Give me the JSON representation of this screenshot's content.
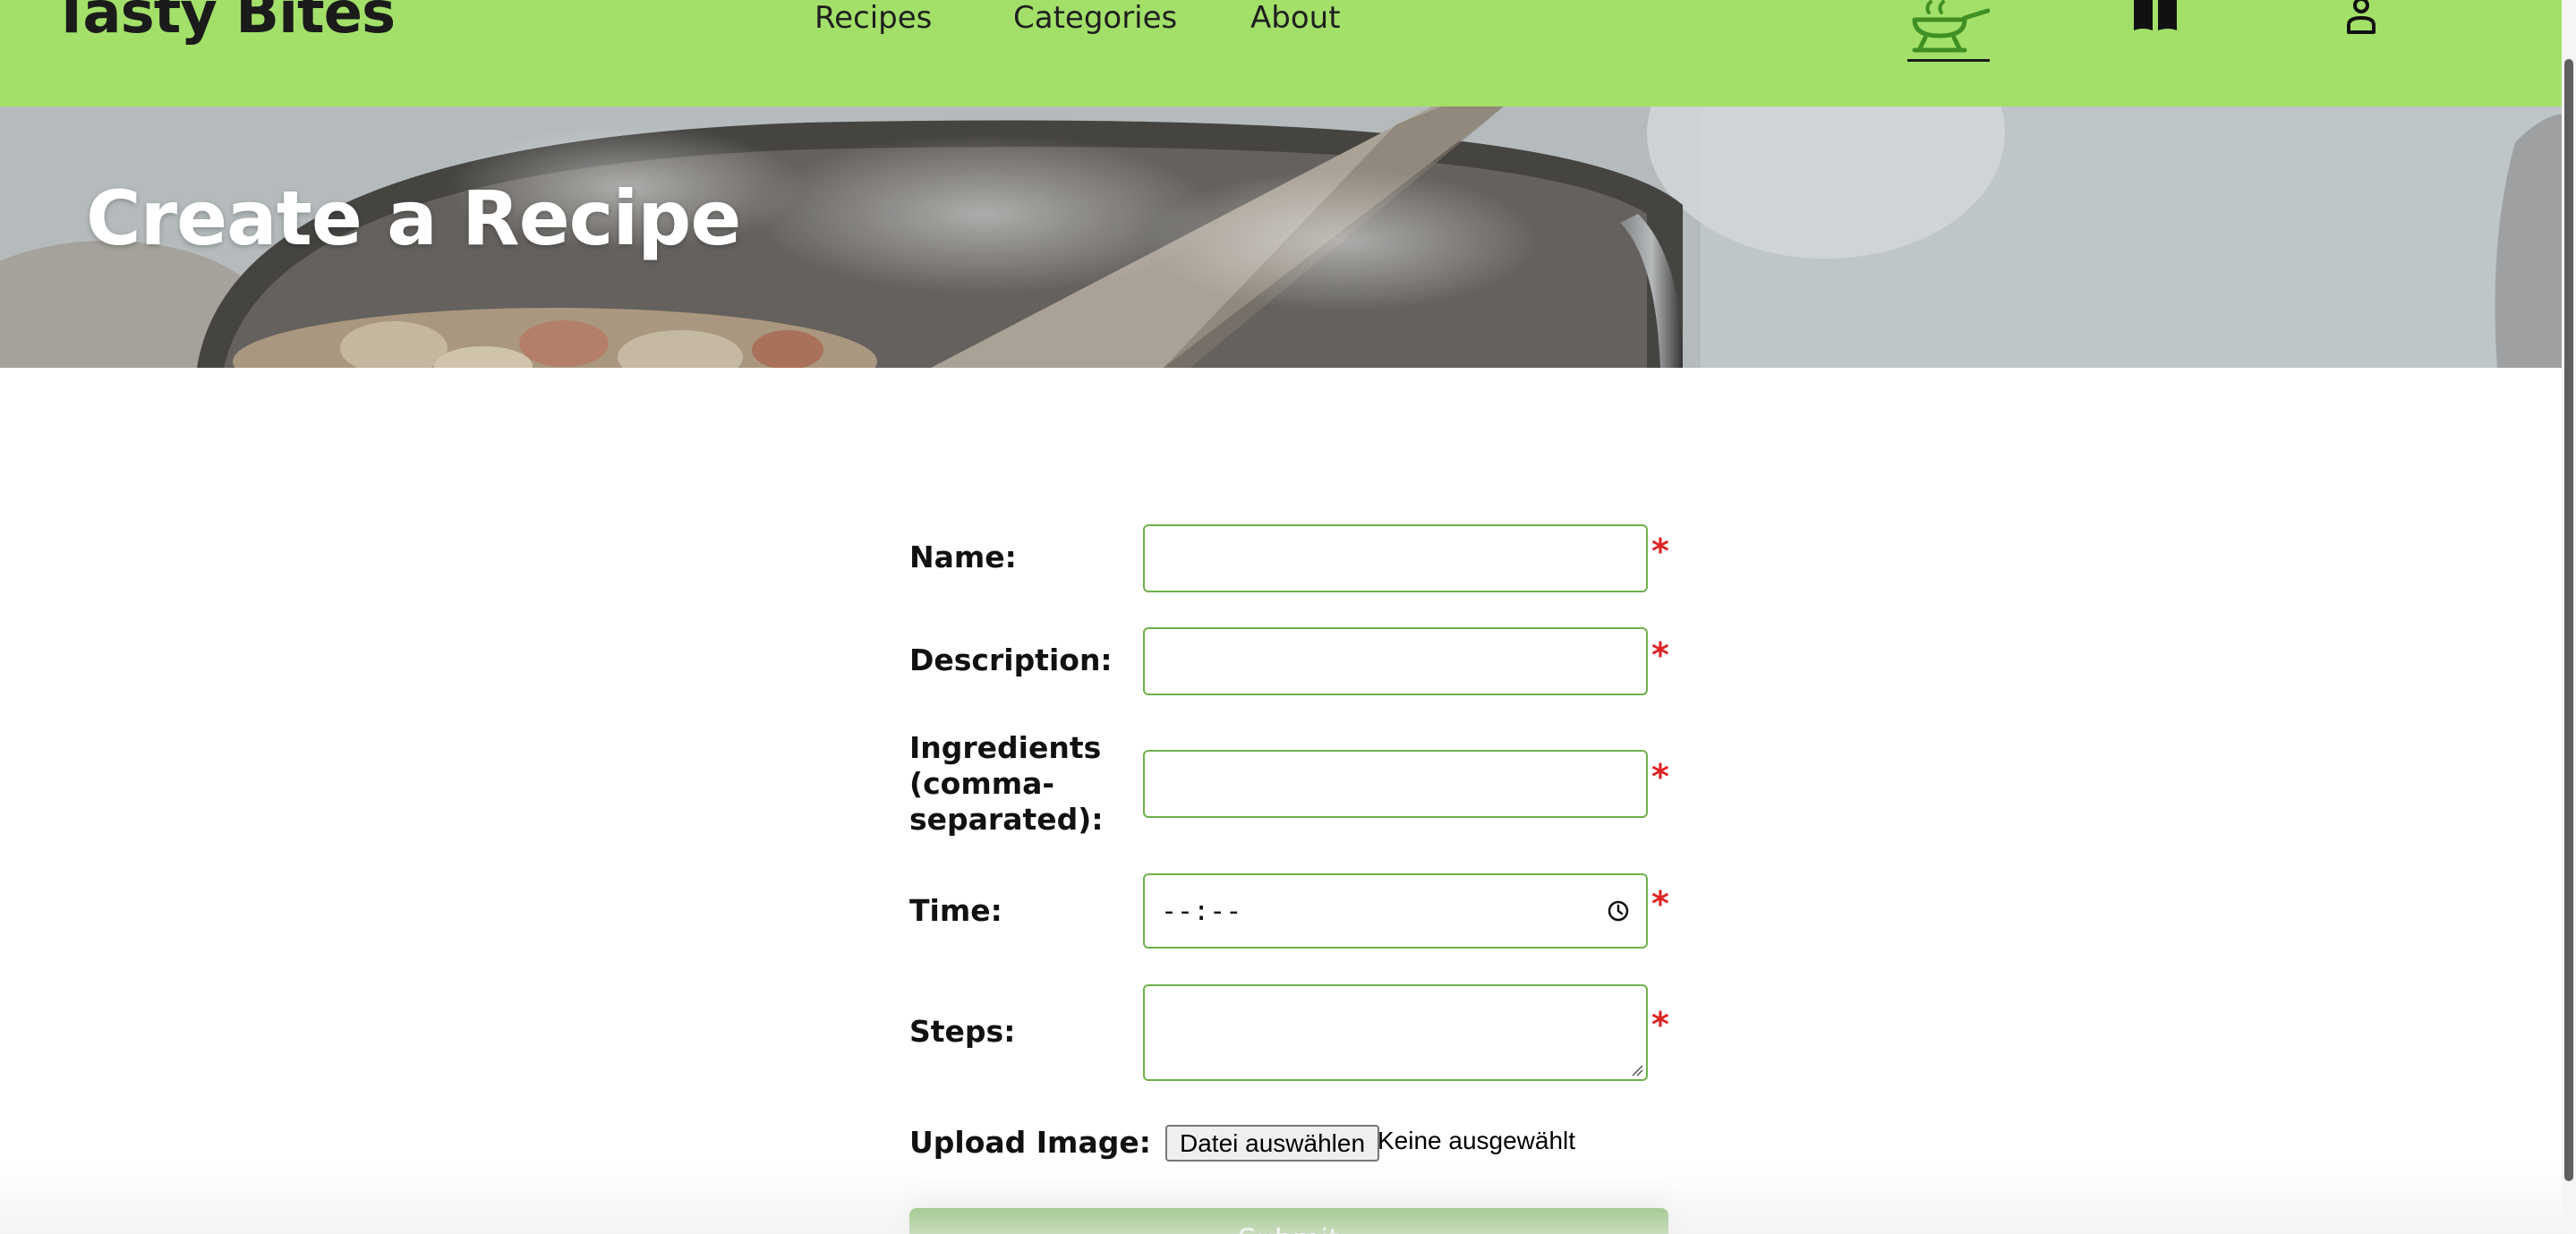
{
  "header": {
    "brand": "Tasty Bites",
    "nav": {
      "recipes": "Recipes",
      "categories": "Categories",
      "about": "About"
    },
    "icons": {
      "create": "cooking-pan-icon",
      "book": "book-icon",
      "user": "user-icon"
    },
    "background_color": "#a3e069"
  },
  "hero": {
    "title": "Create a Recipe"
  },
  "form": {
    "name_label": "Name:",
    "description_label": "Description:",
    "ingredients_label_line1": "Ingredients",
    "ingredients_label_line2": "(comma-",
    "ingredients_label_line3": "separated):",
    "time_label": "Time:",
    "time_placeholder": "--:--",
    "steps_label": "Steps:",
    "upload_label": "Upload Image:",
    "file_button": "Datei auswählen",
    "file_status": "Keine ausgewählt",
    "required_marker": "*",
    "submit_label": "Submit",
    "accent_color": "#6db14b",
    "required_color": "#e02424"
  }
}
